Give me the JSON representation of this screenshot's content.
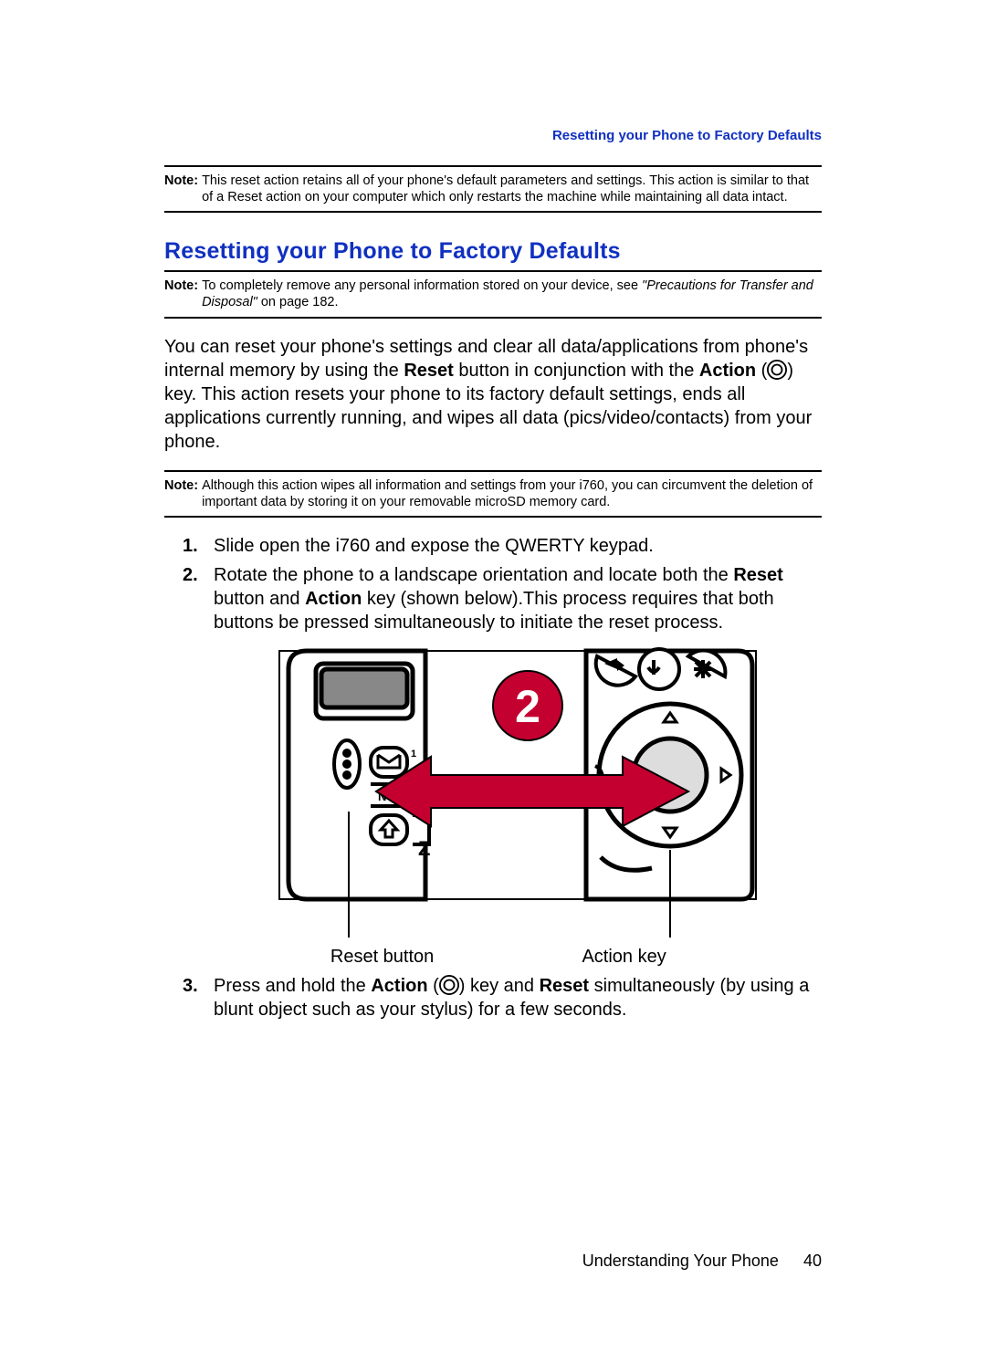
{
  "running_head": "Resetting your Phone to Factory Defaults",
  "note1": {
    "label": "Note:",
    "text": "This reset action retains all of your phone's default parameters and settings. This action is similar to that of a Reset action on your computer which only restarts the machine while maintaining all data intact."
  },
  "section_title": "Resetting your Phone to Factory Defaults",
  "note2": {
    "label": "Note:",
    "pre": "To completely remove any personal information stored on your device, see ",
    "ital": "\"Precautions for Transfer and Disposal\"",
    "post": "  on page 182."
  },
  "body": {
    "p1a": "You can reset your phone's settings and clear all data/applications from phone's internal memory by using the ",
    "reset_b": "Reset",
    "p1b": " button in conjunction with the ",
    "action_b": "Action",
    "p1c": " (",
    "p1d": ") key. This action resets your phone to its factory default settings, ends all applications currently running, and wipes all data (pics/video/contacts) from your phone."
  },
  "note3": {
    "label": "Note:",
    "text": "Although this action wipes all information and settings from your i760, you can circumvent the deletion of important data by storing it on your removable microSD memory card."
  },
  "steps": {
    "s1": "Slide open the i760 and expose the QWERTY keypad.",
    "s2a": "Rotate the phone to a landscape orientation and locate both the ",
    "s2_reset": "Reset",
    "s2b": " button and ",
    "s2_action": "Action",
    "s2c": " key (shown below).This process requires that both buttons be pressed simultaneously to initiate the reset process.",
    "s3a": "Press and hold the ",
    "s3_action": "Action",
    "s3b": " (",
    "s3c": ") key and ",
    "s3_reset": "Reset",
    "s3d": " simultaneously (by using a blunt object such as your stylus) for a few seconds."
  },
  "figure": {
    "badge": "2",
    "reset_label": "Reset button",
    "action_label": "Action key"
  },
  "footer": {
    "chapter": "Understanding Your Phone",
    "page": "40"
  }
}
